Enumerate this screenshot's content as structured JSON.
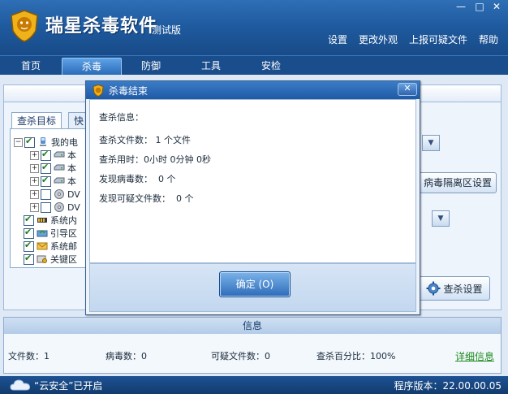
{
  "app": {
    "title": "瑞星杀毒软件",
    "subtitle": "测试版",
    "window_controls": [
      "—",
      "□",
      "✕"
    ]
  },
  "header_links": [
    "设置",
    "更改外观",
    "上报可疑文件",
    "帮助"
  ],
  "nav": {
    "tabs": [
      "首页",
      "杀毒",
      "防御",
      "工具",
      "安检"
    ],
    "active": "杀毒"
  },
  "scan_panel": {
    "tabs": [
      "查杀目标",
      "快"
    ],
    "tree": [
      {
        "label": "我的电",
        "checked": true,
        "indent": 0,
        "icon": "computer-icon"
      },
      {
        "label": "本",
        "checked": true,
        "indent": 1,
        "icon": "drive-icon"
      },
      {
        "label": "本",
        "checked": true,
        "indent": 1,
        "icon": "drive-icon"
      },
      {
        "label": "本",
        "checked": true,
        "indent": 1,
        "icon": "drive-icon"
      },
      {
        "label": "DV",
        "checked": false,
        "indent": 1,
        "icon": "dvd-icon"
      },
      {
        "label": "DV",
        "checked": false,
        "indent": 1,
        "icon": "dvd-icon"
      },
      {
        "label": "系统内",
        "checked": true,
        "indent": 0,
        "icon": "memory-icon"
      },
      {
        "label": "引导区",
        "checked": true,
        "indent": 0,
        "icon": "boot-icon"
      },
      {
        "label": "系统邮",
        "checked": true,
        "indent": 0,
        "icon": "mail-icon"
      },
      {
        "label": "关键区",
        "checked": true,
        "indent": 0,
        "icon": "key-area-icon"
      }
    ],
    "quarantine_button": "病毒隔离区设置",
    "scan_settings_button": "查杀设置"
  },
  "info_bar": {
    "header": "信息",
    "items": [
      "文件数：1",
      "病毒数：0",
      "可疑文件数：0",
      "查杀百分比：100%"
    ],
    "details_link": "详细信息"
  },
  "statusbar": {
    "cloud_text": "“云安全”已开启",
    "version": "程序版本：22.00.00.05"
  },
  "dialog": {
    "title": "杀毒结束",
    "close": "✕",
    "lines": [
      "查杀信息：",
      "查杀文件数： 1 个文件",
      "查杀用时：0小时 0分钟 0秒",
      "发现病毒数：  0 个",
      "发现可疑文件数：  0 个"
    ],
    "ok_button": "确定 (O)"
  },
  "colors": {
    "header": "#1f5ba0",
    "dialog_title": "#2d6bb8",
    "link_green": "#1f8a1f"
  }
}
